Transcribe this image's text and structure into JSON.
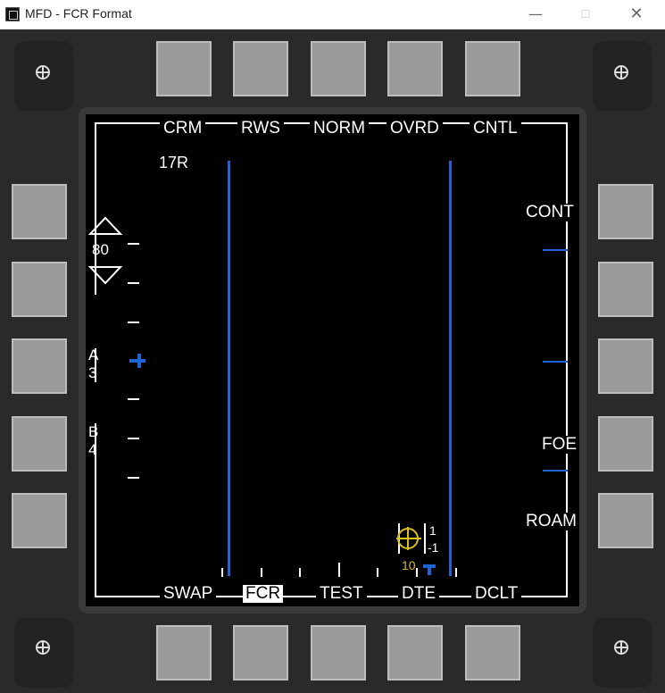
{
  "window": {
    "title": "MFD - FCR Format",
    "controls": {
      "minimize": "—",
      "maximize": "☐",
      "close": "✕"
    }
  },
  "top_labels": [
    "CRM",
    "RWS",
    "NORM",
    "OVRD",
    "CNTL"
  ],
  "bottom_labels": [
    "SWAP",
    "FCR",
    "TEST",
    "DTE",
    "DCLT"
  ],
  "bottom_selected": "FCR",
  "right_labels": [
    "CONT",
    "FOE",
    "ROAM"
  ],
  "range": {
    "bar_label": "17R",
    "scale": "80",
    "az_a": "A",
    "az_a_val": "3",
    "az_b": "B",
    "az_b_val": "4"
  },
  "target": {
    "top": "1",
    "bottom": "-1",
    "range": "10"
  },
  "colors": {
    "bezel": "#2a2a2a",
    "button": "#9a9a9a",
    "screen": "#000000",
    "symbology_white": "#ffffff",
    "symbology_blue": "#1e64d2",
    "symbology_yellow": "#d8c21a"
  }
}
